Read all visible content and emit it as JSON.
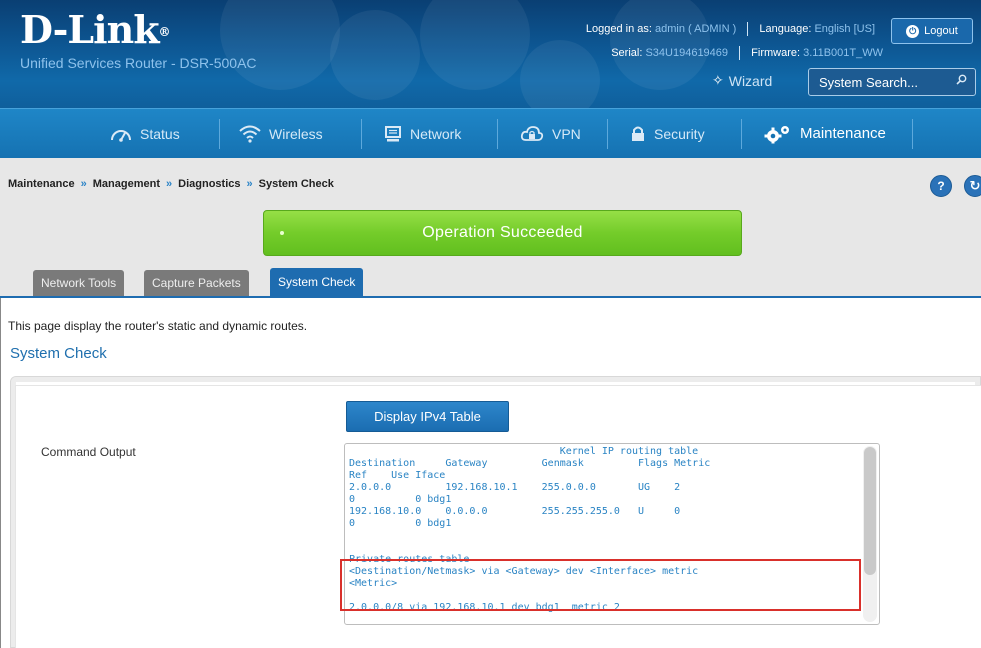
{
  "brand": {
    "logo": "D-Link",
    "registered": "®",
    "product": "Unified Services Router - DSR-500AC"
  },
  "top_info": {
    "logged_in_label": "Logged in as:",
    "logged_in_value": "admin ( ADMIN )",
    "language_label": "Language:",
    "language_value": "English [US]",
    "serial_label": "Serial:",
    "serial_value": "S34U194619469",
    "firmware_label": "Firmware:",
    "firmware_value": "3.11B001T_WW",
    "logout_label": "Logout",
    "wizard_label": "Wizard",
    "search_placeholder": "System Search..."
  },
  "nav": {
    "items": [
      {
        "label": "Status",
        "icon": "gauge-icon"
      },
      {
        "label": "Wireless",
        "icon": "wifi-icon"
      },
      {
        "label": "Network",
        "icon": "monitor-icon"
      },
      {
        "label": "VPN",
        "icon": "cloud-lock-icon"
      },
      {
        "label": "Security",
        "icon": "lock-icon"
      },
      {
        "label": "Maintenance",
        "icon": "gears-icon",
        "active": true
      }
    ]
  },
  "breadcrumb": {
    "items": [
      "Maintenance",
      "Management",
      "Diagnostics",
      "System Check"
    ],
    "separator": "»"
  },
  "status_message": "Operation Succeeded",
  "tabs": [
    {
      "label": "Network Tools"
    },
    {
      "label": "Capture Packets"
    },
    {
      "label": "System Check",
      "active": true
    }
  ],
  "page": {
    "description": "This page display the router's static and dynamic routes.",
    "section_title": "System Check",
    "display_button": "Display IPv4 Table",
    "command_output_label": "Command Output",
    "command_output": "                                   Kernel IP routing table\nDestination     Gateway         Genmask         Flags Metric\nRef    Use Iface\n2.0.0.0         192.168.10.1    255.0.0.0       UG    2\n0          0 bdg1\n192.168.10.0    0.0.0.0         255.255.255.0   U     0\n0          0 bdg1\n\n\nPrivate routes table\n<Destination/Netmask> via <Gateway> dev <Interface> metric\n<Metric>\n\n2.0.0.0/8 via 192.168.10.1 dev bdg1  metric 2"
  },
  "colors": {
    "header_bg": "#0d5591",
    "nav_bg": "#1572b2",
    "success_green": "#74cc2a",
    "tab_active": "#1e6cb0",
    "output_text": "#2a84c4",
    "highlight_red": "#d9302b"
  }
}
